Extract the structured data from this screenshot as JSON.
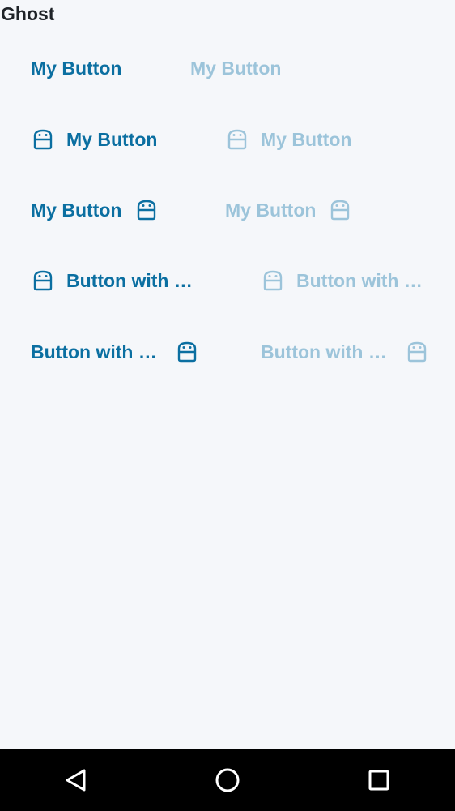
{
  "page": {
    "title": "Ghost"
  },
  "buttons": {
    "row1": {
      "enabled_label": "My Button",
      "disabled_label": "My Button"
    },
    "row2": {
      "enabled_label": "My Button",
      "disabled_label": "My Button",
      "icon": "android-icon",
      "icon_position": "left"
    },
    "row3": {
      "enabled_label": "My Button",
      "disabled_label": "My Button",
      "icon": "android-icon",
      "icon_position": "right"
    },
    "row4": {
      "enabled_label": "Button with …",
      "disabled_label": "Button with …",
      "icon": "android-icon",
      "icon_position": "left"
    },
    "row5": {
      "enabled_label": "Button with …",
      "disabled_label": "Button with …",
      "icon": "android-icon",
      "icon_position": "right"
    }
  },
  "colors": {
    "enabled": "#0b6fa1",
    "disabled": "#9cc4da",
    "background": "#f5f7fa",
    "title": "#1f2328",
    "navbar": "#000000"
  },
  "navbar": {
    "back": "back-triangle-icon",
    "home": "home-circle-icon",
    "recents": "recents-square-icon"
  }
}
